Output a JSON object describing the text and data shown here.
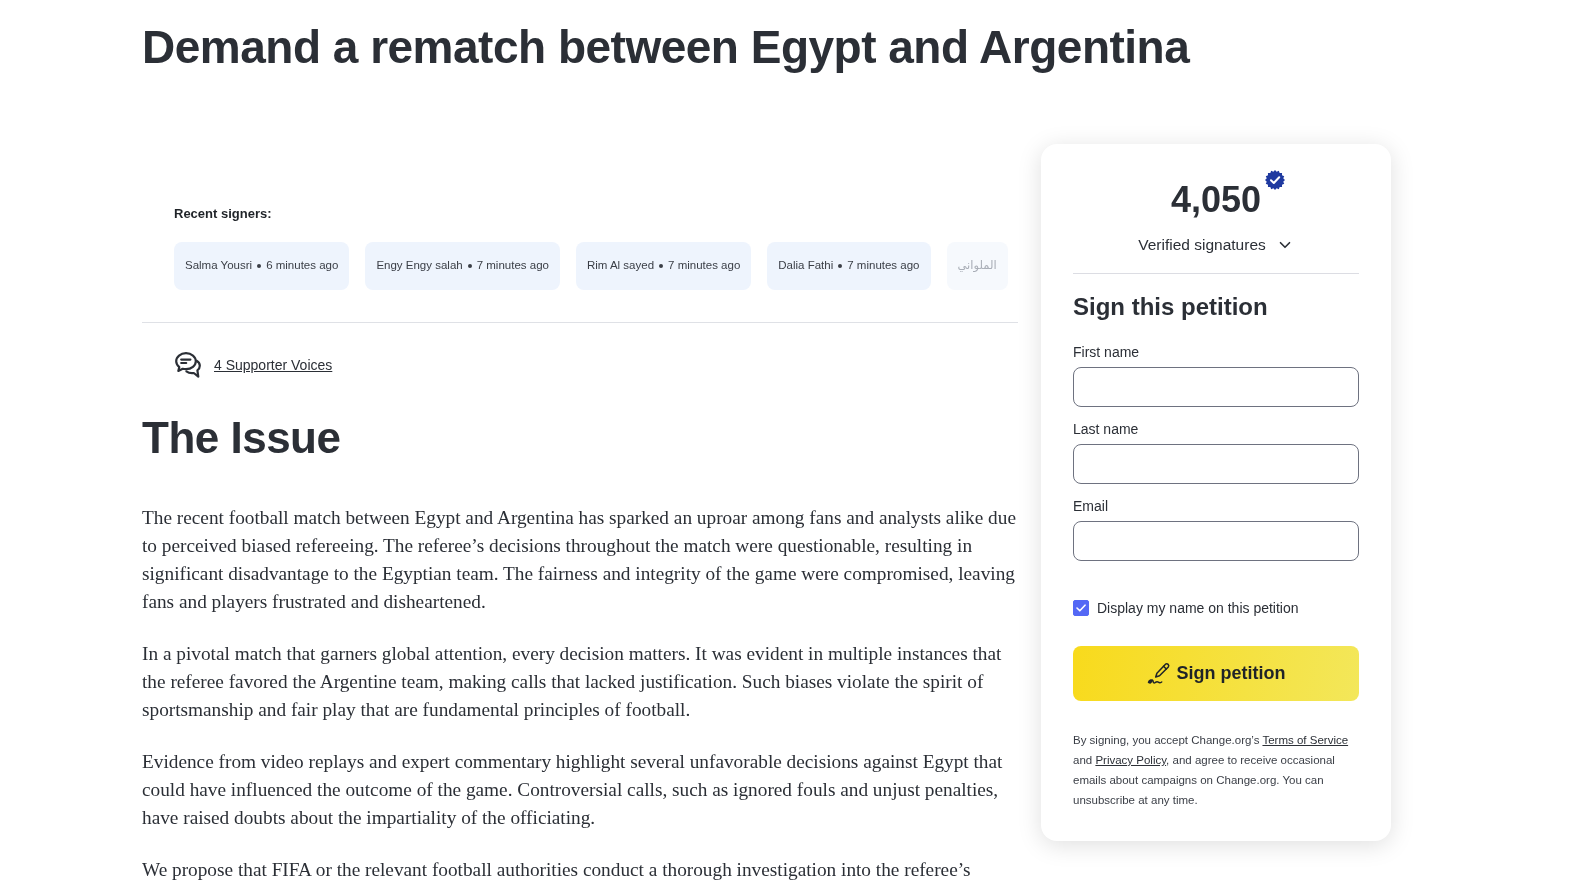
{
  "title": "Demand a rematch between Egypt and Argentina",
  "recent_signers": {
    "label": "Recent signers:",
    "signers": [
      {
        "name": "Salma Yousri",
        "time": "6 minutes ago",
        "faded": false
      },
      {
        "name": "Engy Engy salah",
        "time": "7 minutes ago",
        "faded": false
      },
      {
        "name": "Rim Al sayed",
        "time": "7 minutes ago",
        "faded": false
      },
      {
        "name": "Dalia Fathi",
        "time": "7 minutes ago",
        "faded": false
      },
      {
        "name": "الملواني",
        "faded": true
      }
    ]
  },
  "supporter_voices": {
    "link": "4 Supporter Voices"
  },
  "issue": {
    "heading": "The Issue",
    "paragraphs": [
      "The recent football match between Egypt and Argentina has sparked an uproar among fans and analysts alike due to perceived biased refereeing. The referee’s decisions throughout the match were questionable, resulting in significant disadvantage to the Egyptian team. The fairness and integrity of the game were compromised, leaving fans and players frustrated and disheartened.",
      "In a pivotal match that garners global attention, every decision matters. It was evident in multiple instances that the referee favored the Argentine team, making calls that lacked justification. Such biases violate the spirit of sportsmanship and fair play that are fundamental principles of football.",
      "Evidence from video replays and expert commentary highlight several unfavorable decisions against Egypt that could have influenced the outcome of the game. Controversial calls, such as ignored fouls and unjust penalties, have raised doubts about the impartiality of the officiating.",
      "We propose that FIFA or the relevant football authorities conduct a thorough investigation into the referee’s"
    ]
  },
  "signature_card": {
    "count": "4,050",
    "count_label": "Verified signatures",
    "form_title": "Sign this petition",
    "fields": [
      {
        "label": "First name"
      },
      {
        "label": "Last name"
      },
      {
        "label": "Email"
      }
    ],
    "display_name": {
      "label": "Display my name on this petition",
      "checked": true
    },
    "button": "Sign petition",
    "legal": [
      {
        "kind": "text",
        "text": "By signing, you accept Change.org’s "
      },
      {
        "kind": "link",
        "text": "Terms of Service"
      },
      {
        "kind": "text",
        "text": " and "
      },
      {
        "kind": "link",
        "text": "Privacy Policy"
      },
      {
        "kind": "text",
        "text": ", and agree to receive occasional emails about campaigns on Change.org. You can unsubscribe at any time."
      }
    ]
  }
}
